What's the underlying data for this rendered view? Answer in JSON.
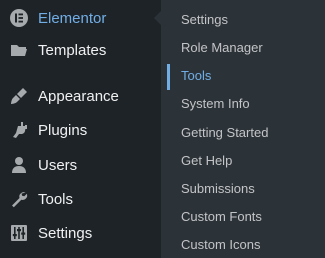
{
  "sidebar": {
    "items": [
      {
        "label": "Elementor",
        "icon": "elementor-icon",
        "active": true
      },
      {
        "label": "Templates",
        "icon": "folder-icon"
      },
      {
        "label": "Appearance",
        "icon": "paintbrush-icon"
      },
      {
        "label": "Plugins",
        "icon": "plugin-icon"
      },
      {
        "label": "Users",
        "icon": "user-icon"
      },
      {
        "label": "Tools",
        "icon": "wrench-icon"
      },
      {
        "label": "Settings",
        "icon": "sliders-icon"
      }
    ]
  },
  "submenu": {
    "items": [
      {
        "label": "Settings"
      },
      {
        "label": "Role Manager"
      },
      {
        "label": "Tools",
        "current": true
      },
      {
        "label": "System Info"
      },
      {
        "label": "Getting Started"
      },
      {
        "label": "Get Help"
      },
      {
        "label": "Submissions"
      },
      {
        "label": "Custom Fonts"
      },
      {
        "label": "Custom Icons"
      }
    ]
  },
  "colors": {
    "sidebar_bg": "#1d2327",
    "submenu_bg": "#2c3338",
    "accent": "#72aee6",
    "text": "#f0f0f1",
    "submenu_text": "#c3c4c7",
    "icon": "#a7aaad"
  }
}
